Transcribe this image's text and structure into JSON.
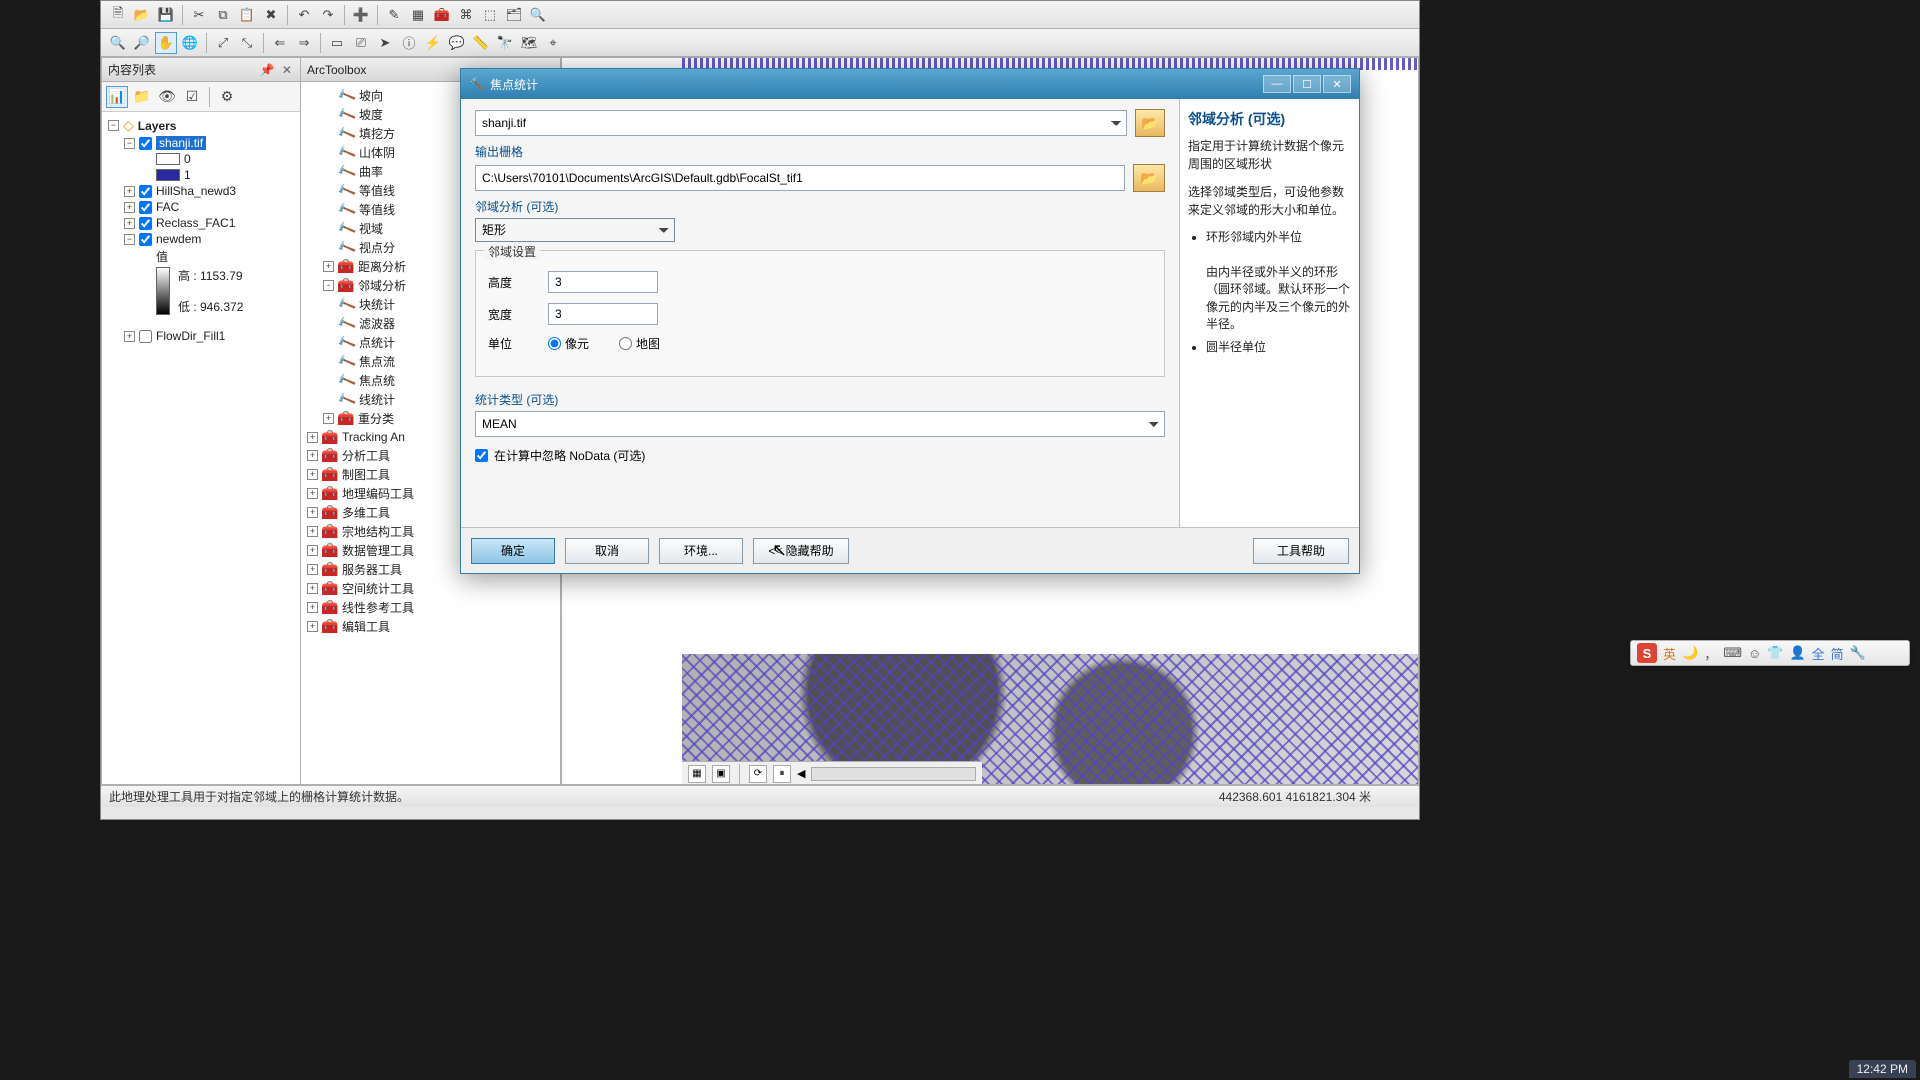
{
  "toc": {
    "title": "内容列表",
    "layers_label": "Layers",
    "items": [
      {
        "name": "shanji.tif",
        "checked": true,
        "highlight": true,
        "leg": [
          {
            "label": "0",
            "color": "#ffffff"
          },
          {
            "label": "1",
            "color": "#2a2aa0"
          }
        ]
      },
      {
        "name": "HillSha_newd3",
        "checked": true
      },
      {
        "name": "FAC",
        "checked": true
      },
      {
        "name": "Reclass_FAC1",
        "checked": true
      },
      {
        "name": "newdem",
        "checked": true,
        "expanded": true,
        "grad": {
          "label": "值",
          "high_label": "高 : 1153.79",
          "low_label": "低 : 946.372"
        }
      },
      {
        "name": "FlowDir_Fill1",
        "checked": false
      }
    ]
  },
  "arctoolbox": {
    "title": "ArcToolbox",
    "tools": [
      "坡向",
      "坡度",
      "填挖方",
      "山体阴",
      "曲率",
      "等值线",
      "等值线",
      "视域",
      "视点分"
    ],
    "toolsets": [
      {
        "name": "距离分析",
        "exp": "+"
      },
      {
        "name": "邻域分析",
        "exp": "-",
        "children": [
          "块统计",
          "滤波器",
          "点统计",
          "焦点流",
          "焦点统",
          "线统计"
        ]
      },
      {
        "name": "重分类",
        "exp": "+"
      }
    ],
    "toolboxes": [
      "Tracking An",
      "分析工具",
      "制图工具",
      "地理编码工具",
      "多维工具",
      "宗地结构工具",
      "数据管理工具",
      "服务器工具",
      "空间统计工具",
      "线性参考工具",
      "编辑工具"
    ]
  },
  "dialog": {
    "title": "焦点统计",
    "input_value": "shanji.tif",
    "output_label": "输出栅格",
    "output_value": "C:\\Users\\70101\\Documents\\ArcGIS\\Default.gdb\\FocalSt_tif1",
    "neighborhood_label": "邻域分析 (可选)",
    "neighborhood_value": "矩形",
    "settings_title": "邻域设置",
    "height_label": "高度",
    "height_value": "3",
    "width_label": "宽度",
    "width_value": "3",
    "unit_label": "单位",
    "unit_cell": "像元",
    "unit_map": "地图",
    "stat_label": "统计类型 (可选)",
    "stat_value": "MEAN",
    "ignore_label": "在计算中忽略 NoData (可选)",
    "ok": "确定",
    "cancel": "取消",
    "env": "环境...",
    "hidehelp": "<< 隐藏帮助",
    "toolhelp": "工具帮助",
    "help_title": "邻域分析 (可选)",
    "help_p1": "指定用于计算统计数据个像元周围的区域形状",
    "help_p2": "选择邻域类型后，可设他参数来定义邻域的形大小和单位。",
    "help_li1": "环形邻域内外半位",
    "help_li1b": "由内半径或外半义的环形（圆环邻域。默认环形一个像元的内半及三个像元的外半径。",
    "help_li2": "圆半径单位"
  },
  "status": {
    "text": "此地理处理工具用于对指定邻域上的栅格计算统计数据。",
    "coords": "442368.601 4161821.304 米"
  },
  "ime": {
    "lang": "英",
    "full": "全",
    "simp": "简"
  },
  "taskbar_time": "12:42 PM"
}
